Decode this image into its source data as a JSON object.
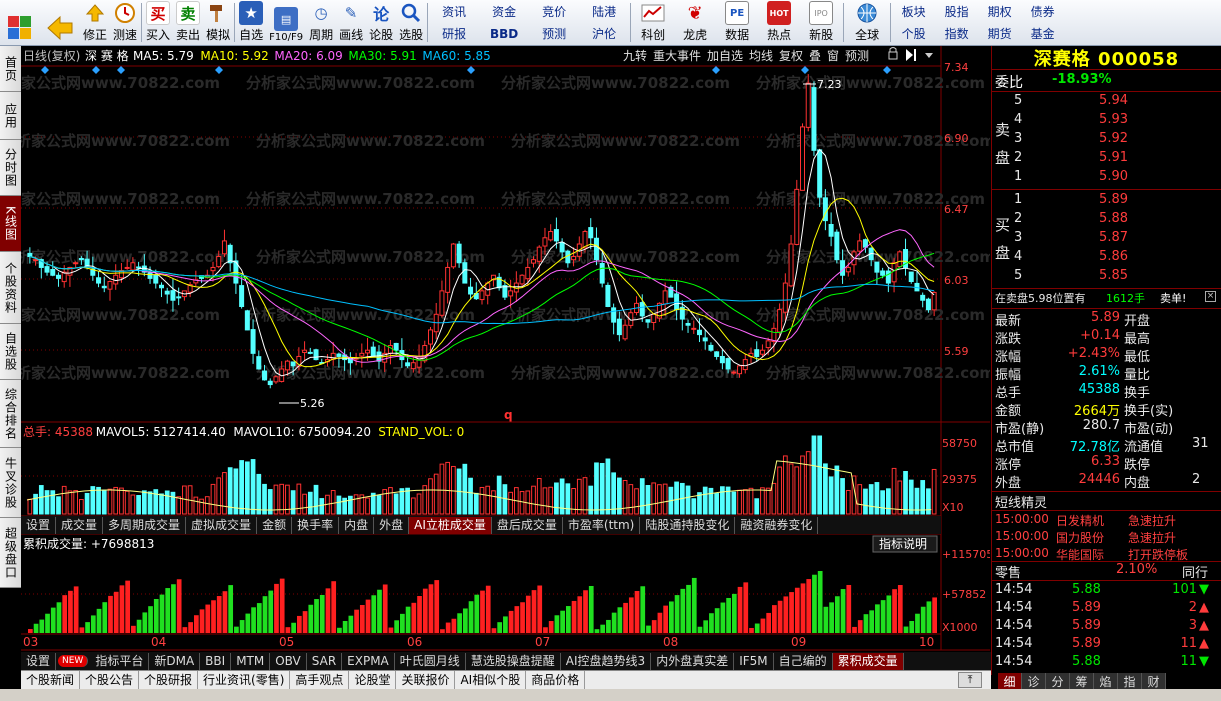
{
  "toolbar": {
    "buttons": [
      {
        "label": "",
        "icon": "grid-icon"
      },
      {
        "label": "",
        "icon": "back-arrow-icon"
      },
      {
        "label": "修正",
        "icon": "up-arrow-icon"
      },
      {
        "label": "测速",
        "icon": "clock-icon"
      },
      {
        "label": "买入",
        "icon": "buy-icon",
        "glyph": "买"
      },
      {
        "label": "卖出",
        "icon": "sell-icon",
        "glyph": "卖"
      },
      {
        "label": "模拟",
        "icon": "hammer-icon"
      },
      {
        "label": "自选",
        "icon": "star-icon"
      },
      {
        "label": "F10/F9",
        "icon": "f10-icon"
      },
      {
        "label": "周期",
        "icon": "period-icon"
      },
      {
        "label": "画线",
        "icon": "pencil-icon"
      },
      {
        "label": "论股",
        "icon": "forum-icon",
        "glyph": "论"
      },
      {
        "label": "选股",
        "icon": "magnifier-icon"
      }
    ],
    "grid1": [
      "资讯",
      "资金",
      "竞价",
      "陆港",
      "研报",
      "BBD",
      "预测",
      "沪伦"
    ],
    "buttons2": [
      {
        "label": "科创",
        "icon": "kechuang-icon"
      },
      {
        "label": "龙虎",
        "icon": "longhu-icon"
      },
      {
        "label": "数据",
        "icon": "pe-icon",
        "glyph": "PE"
      },
      {
        "label": "热点",
        "icon": "hot-icon",
        "glyph": "HOT"
      },
      {
        "label": "新股",
        "icon": "ipo-icon",
        "glyph": "IPO"
      },
      {
        "label": "全球",
        "icon": "globe-icon"
      }
    ],
    "grid2": [
      "板块",
      "股指",
      "期权",
      "债券",
      "个股",
      "指数",
      "期货",
      "基金"
    ]
  },
  "lefttabs": [
    "首页",
    "应用",
    "分时图",
    "K线图",
    "个股资料",
    "自选股",
    "综合排名",
    "牛叉诊股",
    "超级盘口"
  ],
  "chart": {
    "header_left": "日线(复权)",
    "stock_name": "深 赛 格",
    "ma": [
      {
        "label": "MA5: 5.79",
        "color": "#ffffff"
      },
      {
        "label": "MA10: 5.92",
        "color": "#ffff00"
      },
      {
        "label": "MA20: 6.09",
        "color": "#ff66ff"
      },
      {
        "label": "MA30: 5.91",
        "color": "#00ff00"
      },
      {
        "label": "MA60: 5.85",
        "color": "#00c0ff"
      }
    ],
    "header_right": [
      "九转",
      "重大事件",
      "加自选",
      "均线",
      "复权",
      "叠",
      "窗",
      "预测"
    ],
    "watermark": "分析家公式网www.70822.com",
    "price_ticks": [
      "7.34",
      "6.90",
      "6.47",
      "6.03",
      "5.59"
    ],
    "high_label": "7.23",
    "low_label": "5.26",
    "marker_q": "q",
    "vol_header": [
      {
        "text": "总手: 45388",
        "color": "#ff4040"
      },
      {
        "text": "MAVOL5: 5127414.40",
        "color": "#ffffff"
      },
      {
        "text": "MAVOL10: 6750094.20",
        "color": "#ffffff"
      },
      {
        "text": "STAND_VOL: 0",
        "color": "#ffff00"
      }
    ],
    "vol_ticks": [
      "58750",
      "29375",
      "X10"
    ],
    "vol_tabs": [
      "设置",
      "成交量",
      "多周期成交量",
      "虚拟成交量",
      "金额",
      "换手率",
      "内盘",
      "外盘",
      "AI立桩成交量",
      "盘后成交量",
      "市盈率(ttm)",
      "陆股通持股变化",
      "融资融券变化"
    ],
    "vol_tabs_active": 8,
    "cum_header": "累积成交量: +7698813",
    "cum_button": "指标说明",
    "cum_ticks": [
      "+115705",
      "+57852",
      "X1000"
    ],
    "month_labels": [
      "03",
      "04",
      "05",
      "06",
      "07",
      "08",
      "09",
      "10"
    ],
    "ind_tabs": [
      "设置",
      "NEW",
      "指标平台",
      "新DMA",
      "BBI",
      "MTM",
      "OBV",
      "SAR",
      "EXPMA",
      "叶氏圆月线",
      "慧选股操盘提醒",
      "AI控盘趋势线3",
      "内外盘真实差",
      "IF5M",
      "自己编的",
      "累积成交量"
    ],
    "ind_tabs_active": 15
  },
  "chart_data": {
    "type": "candlestick",
    "title": "深赛格 000058 日线(复权)",
    "ylim": [
      5.15,
      7.34
    ],
    "x": [
      "03",
      "04",
      "05",
      "06",
      "07",
      "08",
      "09",
      "10"
    ],
    "price_path": [
      6.12,
      6.1,
      6.05,
      6.02,
      6.0,
      5.98,
      6.02,
      6.05,
      6.08,
      6.1,
      6.06,
      6.0,
      5.95,
      5.92,
      5.96,
      6.0,
      6.03,
      6.05,
      6.08,
      6.05,
      6.02,
      5.98,
      5.95,
      5.92,
      5.88,
      5.84,
      5.86,
      5.9,
      5.94,
      5.97,
      5.98,
      6.0,
      6.05,
      6.12,
      6.22,
      6.08,
      5.95,
      5.8,
      5.65,
      5.5,
      5.4,
      5.33,
      5.3,
      5.35,
      5.4,
      5.45,
      5.42,
      5.48,
      5.52,
      5.5,
      5.46,
      5.44,
      5.46,
      5.5,
      5.48,
      5.46,
      5.44,
      5.47,
      5.5,
      5.52,
      5.48,
      5.45,
      5.5,
      5.55,
      5.52,
      5.46,
      5.42,
      5.44,
      5.48,
      5.55,
      5.65,
      5.75,
      5.9,
      6.05,
      6.2,
      6.08,
      5.95,
      5.88,
      5.85,
      5.9,
      5.95,
      6.0,
      5.92,
      5.86,
      5.9,
      5.95,
      6.0,
      6.05,
      6.1,
      6.18,
      6.24,
      6.28,
      6.22,
      6.15,
      6.08,
      6.12,
      6.2,
      6.28,
      6.24,
      6.1,
      5.95,
      5.8,
      5.7,
      5.62,
      5.68,
      5.76,
      5.82,
      5.74,
      5.7,
      5.75,
      5.82,
      5.9,
      5.86,
      5.78,
      5.72,
      5.68,
      5.66,
      5.62,
      5.58,
      5.52,
      5.48,
      5.44,
      5.4,
      5.38,
      5.42,
      5.46,
      5.5,
      5.48,
      5.52,
      5.58,
      5.66,
      5.78,
      5.95,
      6.2,
      6.55,
      6.95,
      7.23,
      6.8,
      6.5,
      6.35,
      6.25,
      6.1,
      6.0,
      6.05,
      6.15,
      6.22,
      6.18,
      6.1,
      6.02,
      6.0,
      5.95,
      6.08,
      6.15,
      6.05,
      5.96,
      5.9,
      5.84,
      5.78,
      5.89
    ],
    "ma_names": [
      "MA5",
      "MA10",
      "MA20",
      "MA30",
      "MA60"
    ],
    "volume_ylim": [
      0,
      58750
    ],
    "cum_volume_ylim": [
      0,
      115705
    ]
  },
  "quote": {
    "title": "深赛格 000058",
    "weibi_label": "委比",
    "weibi": "-18.93%",
    "sell_label": "卖盘",
    "buy_label": "买盘",
    "sell": [
      {
        "n": "5",
        "p": "5.94"
      },
      {
        "n": "4",
        "p": "5.93"
      },
      {
        "n": "3",
        "p": "5.92"
      },
      {
        "n": "2",
        "p": "5.91"
      },
      {
        "n": "1",
        "p": "5.90"
      }
    ],
    "buy": [
      {
        "n": "1",
        "p": "5.89"
      },
      {
        "n": "2",
        "p": "5.88"
      },
      {
        "n": "3",
        "p": "5.87"
      },
      {
        "n": "4",
        "p": "5.86"
      },
      {
        "n": "5",
        "p": "5.85"
      }
    ],
    "sell_note": "在卖盘5.98位置有",
    "sell_note_qty": "1612手",
    "sell_note_tail": "卖单!",
    "stats": [
      {
        "l": "最新",
        "v": "5.89",
        "c": "red",
        "r": "开盘"
      },
      {
        "l": "涨跌",
        "v": "+0.14",
        "c": "red",
        "r": "最高"
      },
      {
        "l": "涨幅",
        "v": "+2.43%",
        "c": "red",
        "r": "最低"
      },
      {
        "l": "振幅",
        "v": "2.61%",
        "c": "cyan",
        "r": "量比"
      },
      {
        "l": "总手",
        "v": "45388",
        "c": "cyan",
        "r": "换手"
      },
      {
        "l": "金额",
        "v": "2664万",
        "c": "yellow",
        "r": "换手(实)"
      },
      {
        "l": "市盈(静)",
        "v": "280.7",
        "c": "white",
        "r": "市盈(动)"
      },
      {
        "l": "总市值",
        "v": "72.78亿",
        "c": "cyan",
        "r": "流通值",
        "rv": "31"
      },
      {
        "l": "涨停",
        "v": "6.33",
        "c": "red",
        "r": "跌停"
      },
      {
        "l": "外盘",
        "v": "24446",
        "c": "red",
        "r": "内盘",
        "rv": "2"
      }
    ],
    "short_title": "短线精灵",
    "short": [
      {
        "t": "15:00:00",
        "n": "日发精机",
        "e": "急速拉升"
      },
      {
        "t": "15:00:00",
        "n": "国力股份",
        "e": "急速拉升"
      },
      {
        "t": "15:00:00",
        "n": "华能国际",
        "e": "打开跌停板"
      }
    ],
    "ticks_title": "零售",
    "ticks_pct": "2.10%",
    "ticks_tail": "同行",
    "ticks": [
      {
        "t": "14:54",
        "p": "5.88",
        "v": "101",
        "d": "down"
      },
      {
        "t": "14:54",
        "p": "5.89",
        "v": "2",
        "d": "up"
      },
      {
        "t": "14:54",
        "p": "5.89",
        "v": "3",
        "d": "up"
      },
      {
        "t": "14:54",
        "p": "5.89",
        "v": "11",
        "d": "up"
      },
      {
        "t": "14:54",
        "p": "5.88",
        "v": "11",
        "d": "down"
      }
    ],
    "rtabs": [
      "细",
      "诊",
      "分",
      "筹",
      "焰",
      "指",
      "财"
    ]
  },
  "bottomnav": [
    "个股新闻",
    "个股公告",
    "个股研报",
    "行业资讯(零售)",
    "高手观点",
    "论股堂",
    "关联报价",
    "AI相似个股",
    "商品价格"
  ],
  "colors": {
    "up": "#ff3232",
    "down": "#54ffff",
    "bg": "#000000",
    "grid": "#800000"
  }
}
